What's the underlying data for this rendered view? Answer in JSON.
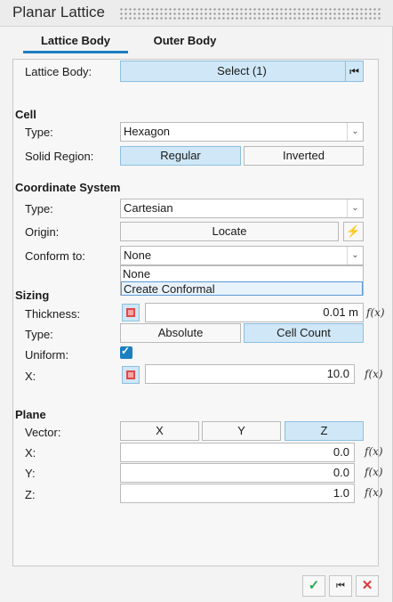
{
  "title": "Planar Lattice",
  "tabs": [
    {
      "label": "Lattice Body",
      "active": true
    },
    {
      "label": "Outer Body",
      "active": false
    }
  ],
  "lattice_body": {
    "label": "Lattice Body:",
    "select_label": "Select (1)"
  },
  "cell": {
    "heading": "Cell",
    "type_label": "Type:",
    "type_value": "Hexagon",
    "solid_region_label": "Solid Region:",
    "regular": "Regular",
    "inverted": "Inverted",
    "solid_region_selected": "Regular"
  },
  "coord": {
    "heading": "Coordinate System",
    "type_label": "Type:",
    "type_value": "Cartesian",
    "origin_label": "Origin:",
    "locate_label": "Locate",
    "conform_label": "Conform to:",
    "conform_value": "None",
    "dropdown_options": [
      "None",
      "Create Conformal"
    ],
    "dropdown_highlighted": "Create Conformal"
  },
  "sizing": {
    "heading": "Sizing",
    "thickness_label": "Thickness:",
    "thickness_value": "0.01 m",
    "type_label": "Type:",
    "absolute": "Absolute",
    "cell_count": "Cell Count",
    "type_selected": "Cell Count",
    "uniform_label": "Uniform:",
    "uniform_checked": true,
    "x_label": "X:",
    "x_value": "10.0"
  },
  "plane": {
    "heading": "Plane",
    "vector_label": "Vector:",
    "vx": "X",
    "vy": "Y",
    "vz": "Z",
    "vector_selected": "Z",
    "x_label": "X:",
    "x_value": "0.0",
    "y_label": "Y:",
    "y_value": "0.0",
    "z_label": "Z:",
    "z_value": "1.0"
  },
  "fx_label": "f(x)",
  "icons": {
    "reset": "reset-icon",
    "lightning": "lightning-icon",
    "dropdown_arrow": "chevron-down-icon",
    "ok": "checkmark-icon",
    "close": "close-icon"
  },
  "colors": {
    "accent": "#1c7fc0",
    "selected_bg": "#cfe7f6",
    "ok_green": "#2fa84f",
    "close_red": "#d93a3a"
  }
}
